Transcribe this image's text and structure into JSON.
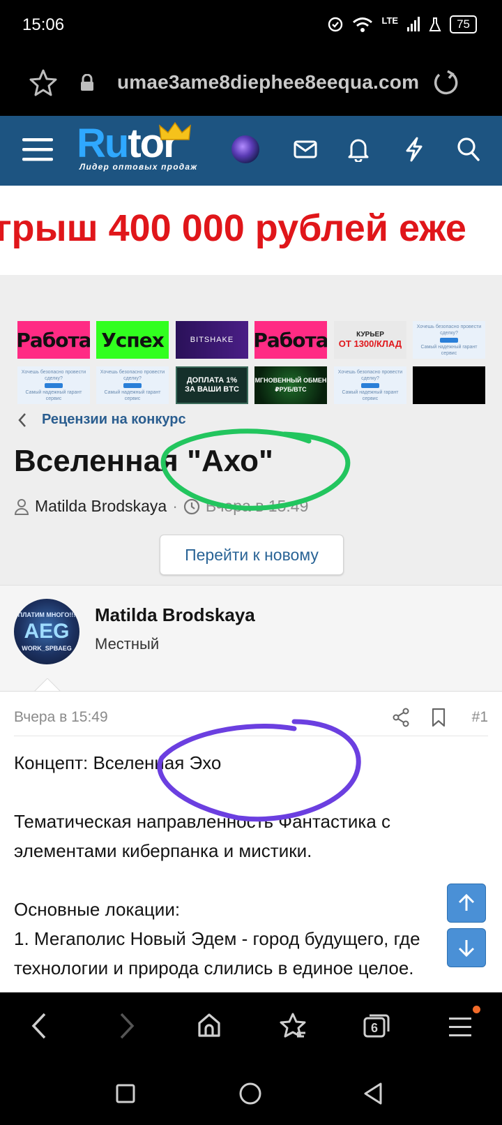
{
  "status": {
    "time": "15:06",
    "network": "LTE",
    "battery": "75"
  },
  "browser": {
    "url": "umae3ame8diephee8eequa.com",
    "tab_count": "6"
  },
  "site": {
    "logo_text_ru": "Ru",
    "logo_text_tor": "tor",
    "logo_tagline": "Лидер оптовых продаж"
  },
  "banner": {
    "text": "грыш 400 000 рублей еже"
  },
  "ads": {
    "rabota": "Работа",
    "uspeh": "Успех",
    "bitshake": "BITSHAKE",
    "courier_line1": "КУРЬЕР",
    "courier_line2": "ОТ 1300/КЛАД",
    "guarant_top": "Хочешь безопасно провести сделку?",
    "guarant_button": "Жми",
    "guarant_bottom": "Самый надежный гарант сервис",
    "doplata_line1": "ДОПЛАТА 1%",
    "doplata_line2": "ЗА ВАШИ BTC",
    "exchange_line1": "МГНОВЕННЫЙ ОБМЕН",
    "exchange_line2": "₽РУБ/BTC"
  },
  "breadcrumb": "Рецензии на конкурс",
  "thread": {
    "title": "Вселенная \"Ахо\"",
    "author": "Matilda Brodskaya",
    "separator": "·",
    "time": "Вчера в 15:49",
    "go_to_new": "Перейти к новому"
  },
  "author_card": {
    "name": "Matilda Brodskaya",
    "role": "Местный",
    "avatar_text": "AEG",
    "avatar_top": "ПЛАТИМ МНОГО!!!",
    "avatar_bottom": "WORK_SPBAEG"
  },
  "post": {
    "date": "Вчера в 15:49",
    "number": "#1",
    "lines": [
      "Концепт: Вселенная Эхо",
      "Тематическая направленность Фантастика с",
      "элементами киберпанка и мистики.",
      "Основные локации:",
      "1. Мегаполис Новый Эдем - город будущего, где",
      "технологии и природа слились в единое целое."
    ]
  },
  "annotations": {
    "green_circle_color": "#22c55e",
    "purple_circle_color": "#6b3fe0"
  }
}
